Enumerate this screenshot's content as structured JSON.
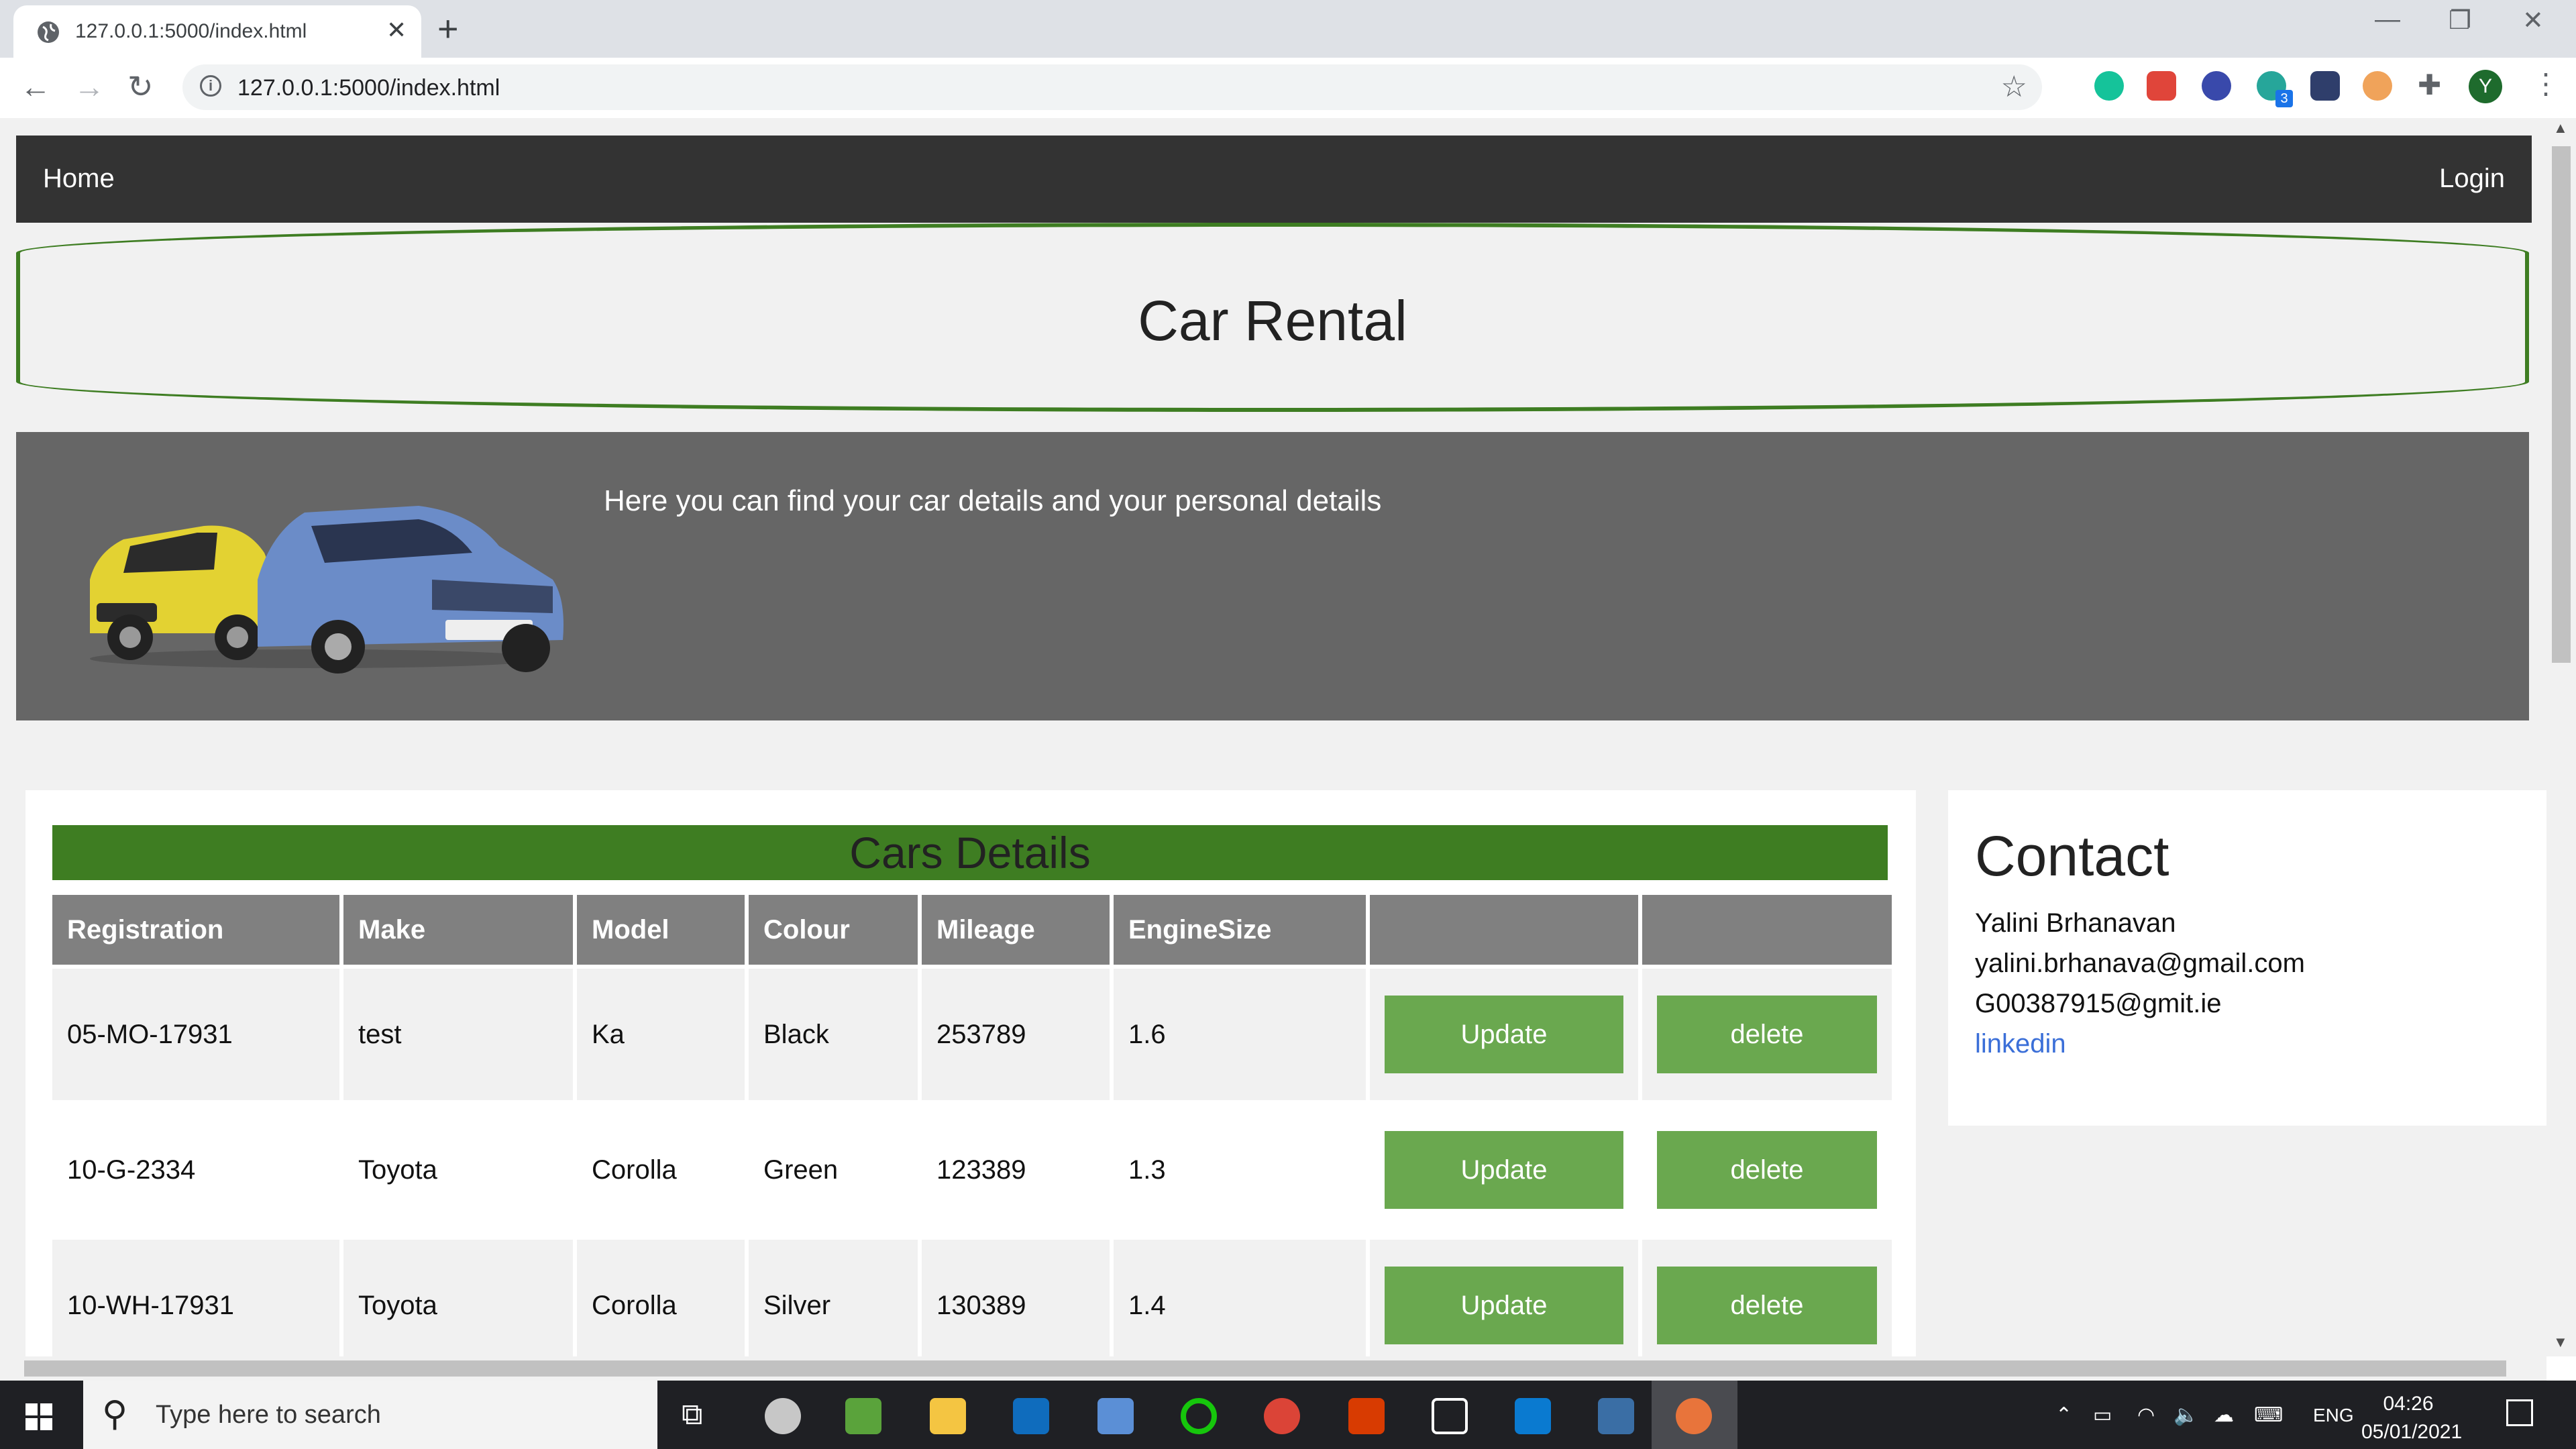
{
  "browser": {
    "tab_title": "127.0.0.1:5000/index.html",
    "url": "127.0.0.1:5000/index.html",
    "profile_initial": "Y",
    "extension_badge": "3"
  },
  "site": {
    "nav": {
      "home": "Home",
      "login": "Login"
    },
    "header_title": "Car Rental",
    "banner_text": "Here you can find your car details and your personal details",
    "cars": {
      "title": "Cars Details",
      "columns": [
        "Registration",
        "Make",
        "Model",
        "Colour",
        "Mileage",
        "EngineSize",
        "",
        ""
      ],
      "rows": [
        {
          "registration": "05-MO-17931",
          "make": "test",
          "model": "Ka",
          "colour": "Black",
          "mileage": "253789",
          "engine": "1.6",
          "update": "Update",
          "delete": "delete"
        },
        {
          "registration": "10-G-2334",
          "make": "Toyota",
          "model": "Corolla",
          "colour": "Green",
          "mileage": "123389",
          "engine": "1.3",
          "update": "Update",
          "delete": "delete"
        },
        {
          "registration": "10-WH-17931",
          "make": "Toyota",
          "model": "Corolla",
          "colour": "Silver",
          "mileage": "130389",
          "engine": "1.4",
          "update": "Update",
          "delete": "delete"
        }
      ]
    },
    "contact": {
      "title": "Contact",
      "name": "Yalini Brhanavan",
      "email1": "yalini.brhanava@gmail.com",
      "email2": "G00387915@gmit.ie",
      "link": "linkedin"
    },
    "colors": {
      "accent_green": "#3e7d22",
      "button_green": "#6aa84f",
      "nav_bg": "#333333",
      "banner_bg": "#666666"
    }
  },
  "taskbar": {
    "search_placeholder": "Type here to search",
    "language": "ENG",
    "time": "04:26",
    "date": "05/01/2021"
  }
}
